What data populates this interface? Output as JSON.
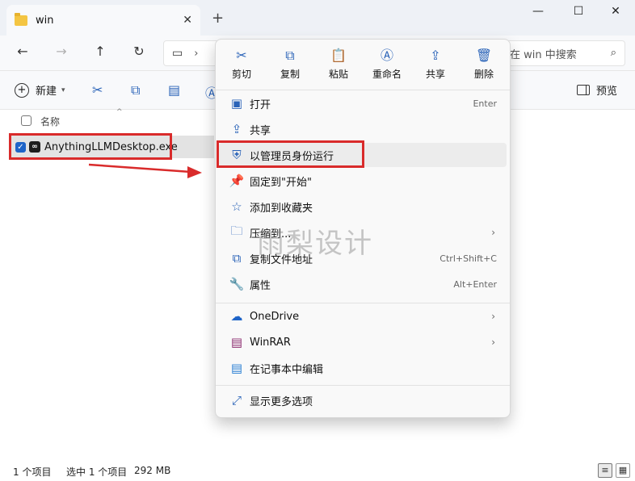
{
  "window": {
    "tab_title": "win",
    "tab_close": "✕",
    "new_tab": "+",
    "minimize": "—",
    "maximize": "☐",
    "close": "✕"
  },
  "nav": {
    "back": "←",
    "forward": "→",
    "up": "↑",
    "refresh": "↻",
    "address_icon": "▭",
    "address_chevron": "›"
  },
  "search": {
    "placeholder": "在 win 中搜索",
    "icon": "search-icon"
  },
  "command_bar": {
    "new_label": "新建",
    "new_plus": "+",
    "new_caret": "▾",
    "preview_label": "预览",
    "icons": [
      "cut-icon",
      "copy-icon",
      "paste-icon",
      "rename-icon"
    ]
  },
  "columns": {
    "name": "名称",
    "sort": "^"
  },
  "file": {
    "checkmark": "✓",
    "icon_text": "∞",
    "name": "AnythingLLMDesktop.exe"
  },
  "context_menu": {
    "top_actions": [
      {
        "label": "剪切",
        "icon": "cut-icon",
        "glyph": "✂"
      },
      {
        "label": "复制",
        "icon": "copy-icon",
        "glyph": "⧉"
      },
      {
        "label": "粘贴",
        "icon": "paste-icon",
        "glyph": "📋"
      },
      {
        "label": "重命名",
        "icon": "rename-icon",
        "glyph": "Ⓐ"
      },
      {
        "label": "共享",
        "icon": "share-icon",
        "glyph": "⇪"
      },
      {
        "label": "删除",
        "icon": "delete-icon",
        "glyph": "🗑"
      }
    ],
    "items": [
      {
        "label": "打开",
        "shortcut": "Enter",
        "icon": "open-icon",
        "glyph": "▣"
      },
      {
        "label": "共享",
        "shortcut": "",
        "icon": "share-icon",
        "glyph": "⇪"
      },
      {
        "label": "以管理员身份运行",
        "shortcut": "",
        "icon": "shield-icon",
        "glyph": "⛨"
      },
      {
        "label": "固定到\"开始\"",
        "shortcut": "",
        "icon": "pin-icon",
        "glyph": "📌"
      },
      {
        "label": "添加到收藏夹",
        "shortcut": "",
        "icon": "star-icon",
        "glyph": "☆"
      },
      {
        "label": "压缩到...",
        "shortcut": "",
        "icon": "zip-icon",
        "glyph": "🗀"
      },
      {
        "label": "复制文件地址",
        "shortcut": "Ctrl+Shift+C",
        "icon": "copy-path-icon",
        "glyph": "⧉"
      },
      {
        "label": "属性",
        "shortcut": "Alt+Enter",
        "icon": "properties-icon",
        "glyph": "🔧"
      }
    ],
    "items2": [
      {
        "label": "OneDrive",
        "icon": "onedrive-icon",
        "glyph": "☁"
      },
      {
        "label": "WinRAR",
        "icon": "winrar-icon",
        "glyph": "▤"
      },
      {
        "label": "在记事本中编辑",
        "icon": "notepad-icon",
        "glyph": "▤"
      }
    ],
    "more": {
      "label": "显示更多选项",
      "icon": "more-options-icon",
      "glyph": "⤢"
    },
    "chevron": "›"
  },
  "status": {
    "count": "1 个项目",
    "selected": "选中 1 个项目",
    "size": "292 MB",
    "details_view": "≡",
    "tiles_view": "▦"
  },
  "watermark": "雨梨设计",
  "colors": {
    "accent": "#2a63b8",
    "highlight_red": "#d92b2b",
    "checkbox_blue": "#1e64c8"
  }
}
